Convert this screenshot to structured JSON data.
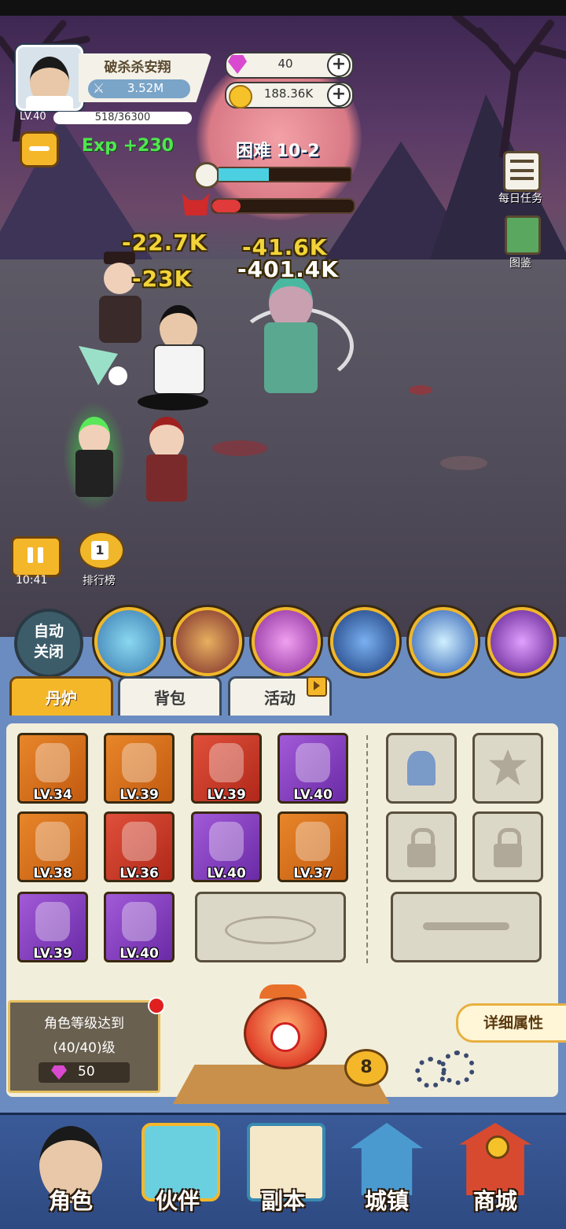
{
  "player": {
    "name": "破杀杀安翔",
    "power": "3.52M",
    "level": "LV.40",
    "xp": "518/36300"
  },
  "currency": {
    "gems": "40",
    "gold": "188.36K"
  },
  "battle": {
    "exp_gain": "Exp +230",
    "stage": "困难 10-2",
    "damage_numbers": [
      "-22.7K",
      "-41.6K",
      "-23K",
      "-401.4K"
    ],
    "timer": "10:41"
  },
  "side_menu": {
    "daily_tasks": "每日任务",
    "codex": "图鉴",
    "ranking": "排行榜",
    "ranking_badge": "1"
  },
  "skills": {
    "auto_toggle": "自动关闭",
    "icons": [
      "dragon-skill-icon",
      "beast-skill-icon",
      "vortex-skill-icon",
      "lightning-scroll-skill-icon",
      "comet-skill-icon",
      "shuriken-skill-icon"
    ]
  },
  "tabs": [
    "丹炉",
    "背包",
    "活动"
  ],
  "equipment": [
    {
      "icon": "spear-icon",
      "level": "LV.34",
      "rarity": "orange"
    },
    {
      "icon": "crown-icon",
      "level": "LV.39",
      "rarity": "orange"
    },
    {
      "icon": "robe-icon",
      "level": "LV.39",
      "rarity": "red"
    },
    {
      "icon": "phoenix-orb-icon",
      "level": "LV.40",
      "rarity": "purple"
    },
    {
      "icon": "armor-icon",
      "level": "LV.38",
      "rarity": "orange"
    },
    {
      "icon": "bagua-icon",
      "level": "LV.36",
      "rarity": "red"
    },
    {
      "icon": "gourd-icon",
      "level": "LV.40",
      "rarity": "purple"
    },
    {
      "icon": "fruit-icon",
      "level": "LV.37",
      "rarity": "orange"
    },
    {
      "icon": "bracelet-icon",
      "level": "LV.39",
      "rarity": "purple"
    },
    {
      "icon": "boots-icon",
      "level": "LV.40",
      "rarity": "purple"
    }
  ],
  "requirement": {
    "line1": "角色等级达到",
    "line2": "(40/40)级",
    "reward": "50"
  },
  "furnace": {
    "count": "8",
    "detail_button": "详细属性"
  },
  "nav": [
    "角色",
    "伙伴",
    "副本",
    "城镇",
    "商城"
  ],
  "colors": {
    "accent_gold": "#f5b72a",
    "nav_blue": "#3a5a98",
    "panel_cream": "#f2eedc"
  }
}
